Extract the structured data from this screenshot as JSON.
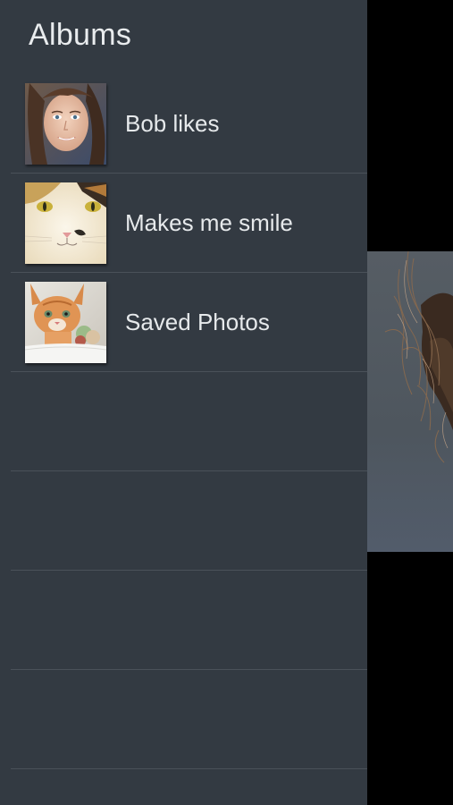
{
  "drawer": {
    "title": "Albums",
    "albums": [
      {
        "label": "Bob likes",
        "thumbnail": "woman-portrait-thumbnail"
      },
      {
        "label": "Makes me smile",
        "thumbnail": "white-cat-thumbnail"
      },
      {
        "label": "Saved Photos",
        "thumbnail": "kitten-thumbnail"
      }
    ],
    "empty_rows": 4
  },
  "colors": {
    "drawer_background": "#333a42",
    "divider": "#4a5159",
    "text": "#e6e9eb",
    "backdrop": "#000000"
  },
  "preview": {
    "image": "woman-hair-photo"
  }
}
